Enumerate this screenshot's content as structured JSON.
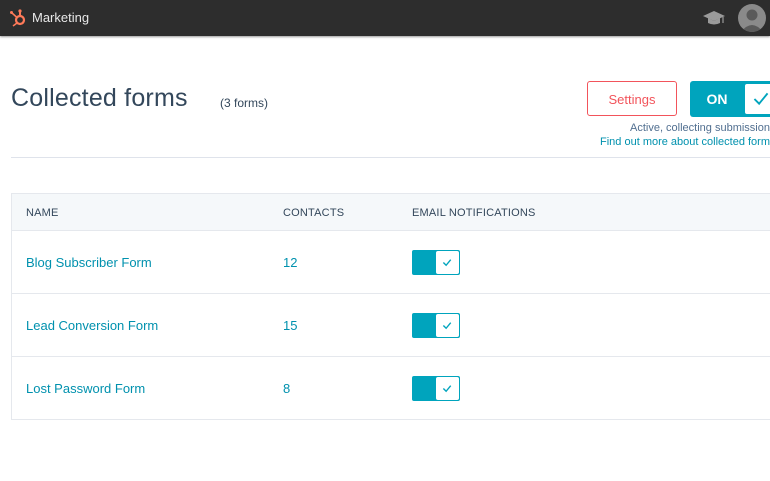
{
  "topbar": {
    "app_title": "Marketing",
    "icons": [
      "hubspot-logo-icon",
      "graduation-cap-icon",
      "user-avatar-icon"
    ]
  },
  "header": {
    "title": "Collected forms",
    "count_label": "(3 forms)",
    "settings_label": "Settings",
    "toggle_label": "ON",
    "status_text": "Active, collecting submission",
    "learn_more_link": "Find out more about collected form"
  },
  "table": {
    "columns": [
      "NAME",
      "CONTACTS",
      "EMAIL NOTIFICATIONS"
    ],
    "rows": [
      {
        "name": "Blog Subscriber Form",
        "contacts": "12",
        "notifications": true
      },
      {
        "name": "Lead Conversion Form",
        "contacts": "15",
        "notifications": true
      },
      {
        "name": "Lost Password Form",
        "contacts": "8",
        "notifications": true
      }
    ]
  },
  "colors": {
    "accent": "#00a4bd",
    "link": "#0091ae",
    "settings_border": "#f2545b",
    "topbar": "#2d2d2d",
    "logo": "#ff7a59"
  }
}
